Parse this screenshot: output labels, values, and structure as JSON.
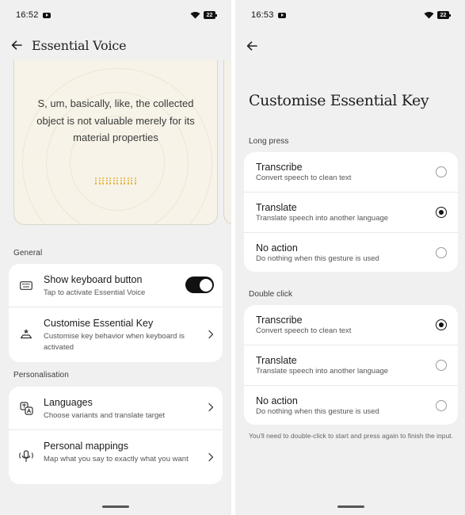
{
  "left_screen": {
    "status_bar": {
      "time": "16:52",
      "battery": "22",
      "notification_icon": "youtube-icon"
    },
    "header": {
      "title": "Essential Voice",
      "back_icon": "arrow-left-icon"
    },
    "preview": {
      "text": "S, um, basically, like, the collected object is not valuable merely for its material properties"
    },
    "general": {
      "label": "General",
      "show_keyboard": {
        "title": "Show keyboard button",
        "subtitle": "Tap to activate Essential Voice",
        "icon": "keyboard-icon",
        "toggle_on": true
      },
      "customise_key": {
        "title": "Customise Essential Key",
        "subtitle": "Customise key behavior when keyboard is activated",
        "icon": "essential-key-icon"
      }
    },
    "personalisation": {
      "label": "Personalisation",
      "languages": {
        "title": "Languages",
        "subtitle": "Choose variants and translate target",
        "icon": "translate-icon"
      },
      "personal_mappings": {
        "title": "Personal mappings",
        "subtitle": "Map what you say to exactly what you want",
        "icon": "voice-mapping-icon"
      }
    }
  },
  "right_screen": {
    "status_bar": {
      "time": "16:53",
      "battery": "22",
      "notification_icon": "youtube-icon"
    },
    "title": "Customise Essential Key",
    "long_press": {
      "label": "Long press",
      "selected": "translate",
      "options": [
        {
          "id": "transcribe",
          "title": "Transcribe",
          "subtitle": "Convert speech to clean text",
          "selected": false
        },
        {
          "id": "translate",
          "title": "Translate",
          "subtitle": "Translate speech into another language",
          "selected": true
        },
        {
          "id": "no_action",
          "title": "No action",
          "subtitle": "Do nothing when this gesture is used",
          "selected": false
        }
      ]
    },
    "double_click": {
      "label": "Double click",
      "selected": "transcribe",
      "options": [
        {
          "id": "transcribe",
          "title": "Transcribe",
          "subtitle": "Convert speech to clean text",
          "selected": true
        },
        {
          "id": "translate",
          "title": "Translate",
          "subtitle": "Translate speech into another language",
          "selected": false
        },
        {
          "id": "no_action",
          "title": "No action",
          "subtitle": "Do nothing when this gesture is used",
          "selected": false
        }
      ]
    },
    "footnote": "You'll need to double-click to start and press again to finish the input."
  },
  "colors": {
    "background": "#f0f0f0",
    "card": "#ffffff",
    "accent_dots": "#e3b23c",
    "toggle_on": "#111111"
  }
}
